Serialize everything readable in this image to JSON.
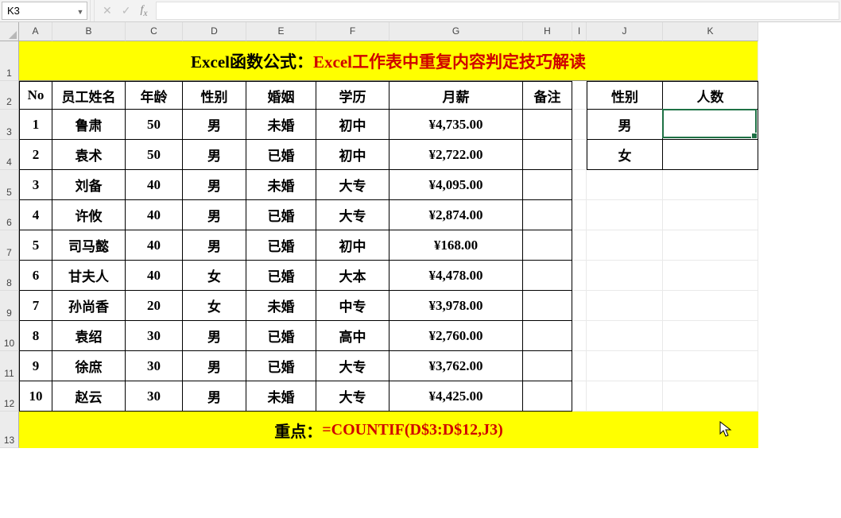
{
  "nameBox": "K3",
  "formula": "",
  "title": {
    "a": "Excel函数公式：",
    "b": "Excel工作表中重复内容判定技巧解读"
  },
  "colHeaders": [
    "A",
    "B",
    "C",
    "D",
    "E",
    "F",
    "G",
    "H",
    "I",
    "J",
    "K"
  ],
  "rowHeaders": [
    "1",
    "2",
    "3",
    "4",
    "5",
    "6",
    "7",
    "8",
    "9",
    "10",
    "11",
    "12",
    "13"
  ],
  "headers": {
    "A": "No",
    "B": "员工姓名",
    "C": "年龄",
    "D": "性别",
    "E": "婚姻",
    "F": "学历",
    "G": "月薪",
    "H": "备注",
    "J": "性别",
    "K": "人数"
  },
  "rows": [
    {
      "no": "1",
      "name": "鲁肃",
      "age": "50",
      "sex": "男",
      "mar": "未婚",
      "edu": "初中",
      "sal": "¥4,735.00",
      "note": ""
    },
    {
      "no": "2",
      "name": "袁术",
      "age": "50",
      "sex": "男",
      "mar": "已婚",
      "edu": "初中",
      "sal": "¥2,722.00",
      "note": ""
    },
    {
      "no": "3",
      "name": "刘备",
      "age": "40",
      "sex": "男",
      "mar": "未婚",
      "edu": "大专",
      "sal": "¥4,095.00",
      "note": ""
    },
    {
      "no": "4",
      "name": "许攸",
      "age": "40",
      "sex": "男",
      "mar": "已婚",
      "edu": "大专",
      "sal": "¥2,874.00",
      "note": ""
    },
    {
      "no": "5",
      "name": "司马懿",
      "age": "40",
      "sex": "男",
      "mar": "已婚",
      "edu": "初中",
      "sal": "¥168.00",
      "note": ""
    },
    {
      "no": "6",
      "name": "甘夫人",
      "age": "40",
      "sex": "女",
      "mar": "已婚",
      "edu": "大本",
      "sal": "¥4,478.00",
      "note": ""
    },
    {
      "no": "7",
      "name": "孙尚香",
      "age": "20",
      "sex": "女",
      "mar": "未婚",
      "edu": "中专",
      "sal": "¥3,978.00",
      "note": ""
    },
    {
      "no": "8",
      "name": "袁绍",
      "age": "30",
      "sex": "男",
      "mar": "已婚",
      "edu": "高中",
      "sal": "¥2,760.00",
      "note": ""
    },
    {
      "no": "9",
      "name": "徐庶",
      "age": "30",
      "sex": "男",
      "mar": "已婚",
      "edu": "大专",
      "sal": "¥3,762.00",
      "note": ""
    },
    {
      "no": "10",
      "name": "赵云",
      "age": "30",
      "sex": "男",
      "mar": "未婚",
      "edu": "大专",
      "sal": "¥4,425.00",
      "note": ""
    }
  ],
  "side": [
    {
      "sex": "男",
      "count": ""
    },
    {
      "sex": "女",
      "count": ""
    }
  ],
  "footer": {
    "a": "重点：",
    "b": "=COUNTIF(D$3:D$12,J3)"
  },
  "selectedCell": "K3"
}
